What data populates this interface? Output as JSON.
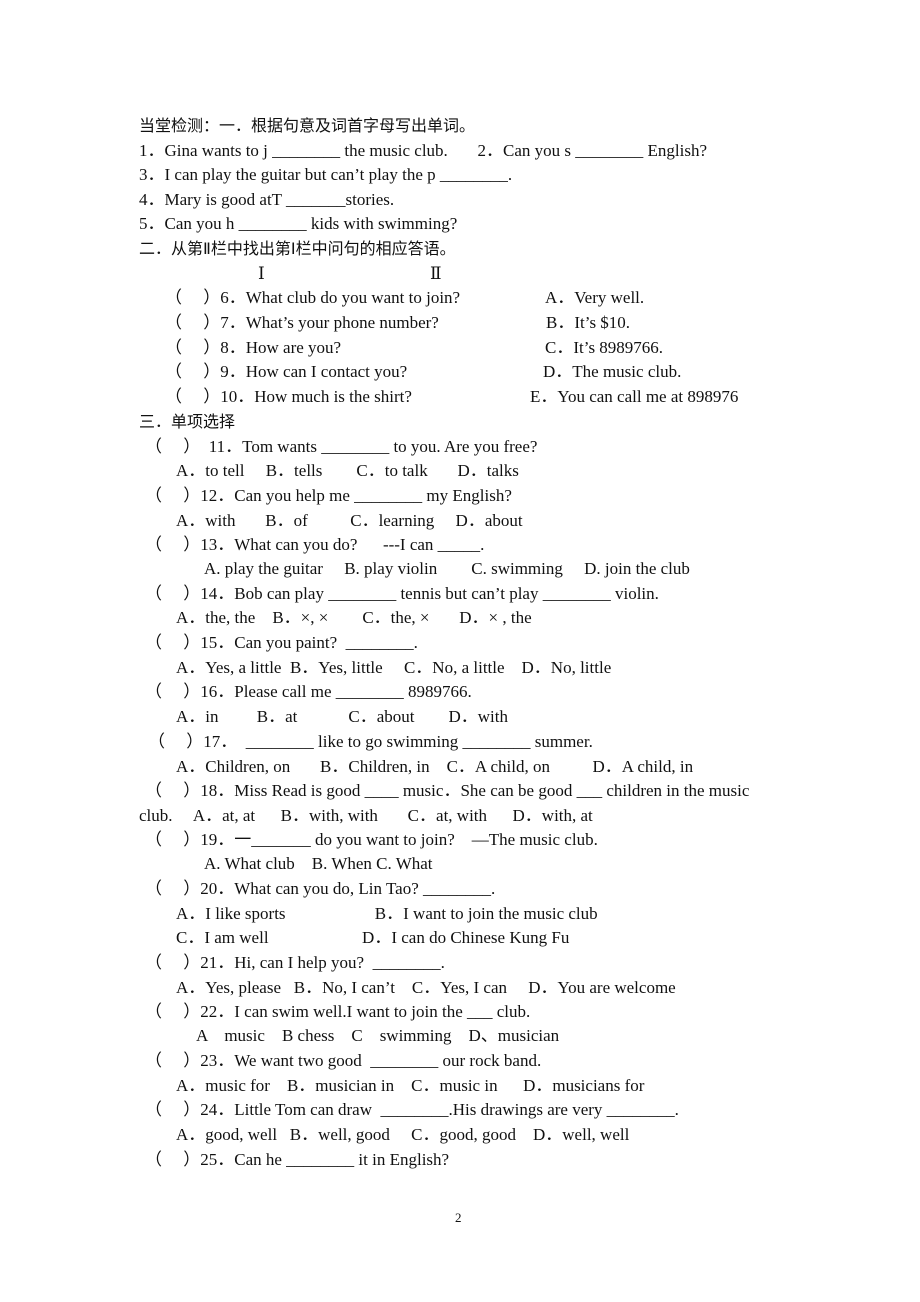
{
  "section1": {
    "heading": "当堂检测：一．根据句意及词首字母写出单词。",
    "items": [
      "1．Gina wants to j ________ the music club.       2．Can you s ________ English?",
      "3．I can play the guitar but can’t play the p ________.",
      "4．Mary is good atT _______stories.",
      "5．Can you h ________ kids with swimming?"
    ]
  },
  "section2": {
    "heading": "二．从第Ⅱ栏中找出第Ⅰ栏中问句的相应答语。",
    "col1_label": "Ⅰ",
    "col2_label": "Ⅱ",
    "questions": [
      "（　 ）6．What club do you want to join?",
      "（　 ）7．What’s your phone number?",
      "（　 ）8．How are you?",
      "（　 ）9．How can I contact you?",
      "（　 ）10．How much is the shirt?"
    ],
    "answers": [
      "A．Very well.",
      "B．It’s $10.",
      "C．It’s 8989766.",
      "D．The music club.",
      "E．You can call me at 898976"
    ]
  },
  "section3": {
    "heading": "三．单项选择",
    "lines": [
      "（　 ）  11．Tom wants ________ to you. Are you free?",
      "A．to tell     B．tells        C．to talk       D．talks",
      "（　 ）12．Can you help me ________ my English?",
      "A．with       B．of          C．learning     D．about",
      "（　 ）13．What can you do?      ---I can _____.",
      "A. play the guitar     B. play violin        C. swimming     D. join the club",
      "（　 ）14．Bob can play ________ tennis but can’t play ________ violin.",
      "A．the, the    B．×, ×        C．the, ×       D．× , the",
      "（　 ）15．Can you paint?  ________.",
      "A．Yes, a little  B．Yes, little     C．No, a little    D．No, little",
      "（　 ）16．Please call me ________ 8989766.",
      "A．in         B．at            C．about        D．with",
      "（　 ）17．  ________ like to go swimming ________ summer.",
      "A．Children, on       B．Children, in    C．A child, on          D．A child, in",
      "（　 ）18．Miss Read is good ____ music．She can be good ___ children in the music",
      "club.     A．at, at      B．with, with       C．at, with      D．with, at",
      "（　 ）19．一_______ do you want to join?    —The music club.",
      "A. What club    B. When C. What",
      "（　 ）20．What can you do, Lin Tao? ________.",
      "A．I like sports                     B．I want to join the music club",
      "C．I am well                      D．I can do Chinese Kung Fu",
      "（　 ）21．Hi, can I help you?  ________.",
      "A．Yes, please   B．No, I can’t    C．Yes, I can     D．You are welcome",
      "（　 ）22．I can swim well.I want to join the ___ club.",
      "A    music    B chess    C    swimming    D、musician",
      "（　 ）23．We want two good  ________ our rock band.",
      "A．music for    B．musician in    C．music in      D．musicians for",
      "（　 ）24．Little Tom can draw  ________.His drawings are very ________.",
      "A．good, well   B．well, good     C．good, good    D．well, well",
      "（　 ）25．Can he ________ it in English?"
    ]
  },
  "footer": {
    "page_number": "2"
  }
}
